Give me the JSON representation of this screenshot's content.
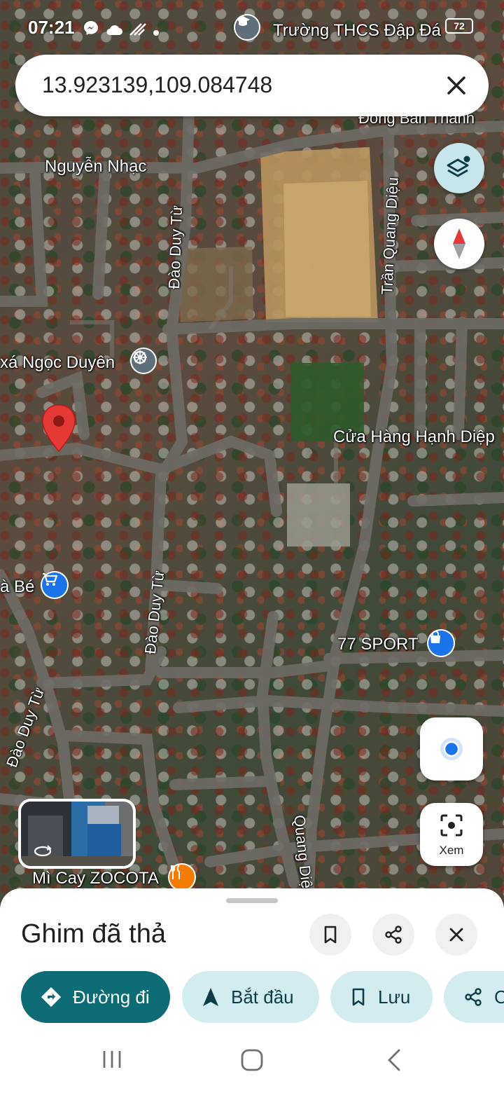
{
  "status_bar": {
    "time": "07:21",
    "battery": "72"
  },
  "search": {
    "value": "13.923139,109.084748",
    "close_icon": "close-icon"
  },
  "map": {
    "labels": {
      "school": "Trường THCS Đập Đá",
      "dong_ban_thanh": "Đông Bàn Thành",
      "nguyen_nhac": "Nguyễn Nhạc",
      "dao_duy_tu_1": "Đào Duy Từ",
      "tran_quang_dieu_1": "Trần Quang Diệu",
      "ngoc_duyen": "xá Ngọc Duyên",
      "hanh_diep": "Cửa Hàng Hạnh Diệp",
      "ba_be": "à Bé",
      "dao_duy_tu_2": "Đào Duy Từ",
      "sport": "77 SPORT",
      "dao_duy_tu_3": "Đào Duy Từ",
      "tran_quang_dieu_2": "Quang Diệu",
      "mi_cay": "Mì Cay ZOCOTA"
    },
    "lens_label": "Xem"
  },
  "sheet": {
    "title": "Ghim đã thả",
    "chips": {
      "directions": "Đường đi",
      "start": "Bắt đầu",
      "save": "Lưu",
      "share": "C"
    }
  },
  "colors": {
    "primary_chip": "#0c6b75",
    "secondary_chip": "#d3ecf0",
    "pin_red": "#e53935",
    "location_blue": "#1a73e8"
  }
}
